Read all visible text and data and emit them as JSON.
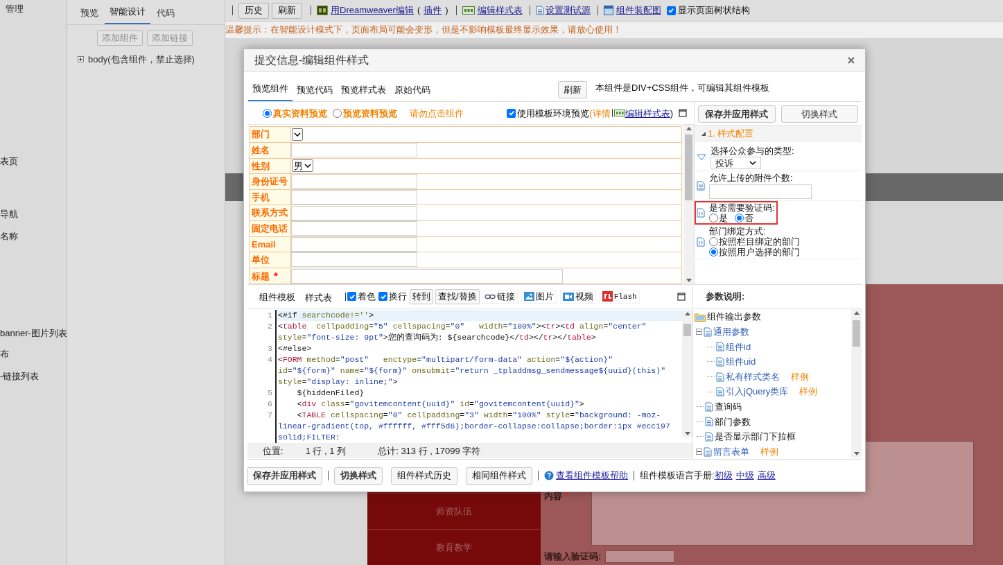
{
  "background": {
    "left_labels": [
      "管理",
      "表页",
      "导航",
      "名称",
      "banner-图片列表",
      "布",
      "-链接列表"
    ],
    "tabs": [
      {
        "label": "预览",
        "selected": false
      },
      {
        "label": "智能设计",
        "selected": true
      },
      {
        "label": "代码",
        "selected": false
      }
    ],
    "sidebar_buttons": [
      {
        "label": "添加组件",
        "disabled": true
      },
      {
        "label": "添加链接",
        "disabled": true
      }
    ],
    "tree_item": "body(包含组件，禁止选择)",
    "toolbar": [
      {
        "kind": "button",
        "label": "历史",
        "sep_before": true
      },
      {
        "kind": "button",
        "label": "刷新",
        "sep_before": false
      },
      {
        "kind": "link",
        "label": "用Dreamweaver编辑",
        "sep_before": true
      },
      {
        "kind": "text",
        "label": "(",
        "sep_before": false
      },
      {
        "kind": "link",
        "label": "插件",
        "sep_before": false
      },
      {
        "kind": "text",
        "label": ")",
        "sep_before": false
      },
      {
        "kind": "link",
        "label": "编辑样式表",
        "sep_before": true
      },
      {
        "kind": "link",
        "label": "设置测试源",
        "sep_before": true
      },
      {
        "kind": "link",
        "label": "组件装配图",
        "sep_before": true
      },
      {
        "kind": "checkbox",
        "label": "显示页面树状结构",
        "checked": true,
        "sep_before": false
      }
    ],
    "notice": "温馨提示：在智能设计模式下，页面布局可能会变形，但是不影响模板最终显示效果，请放心使用！",
    "canvas": {
      "cells": [
        "师资队伍",
        "教育教学"
      ],
      "content_label": "内容",
      "content_required": true,
      "content_required_mark": "*",
      "captcha_label": "请输入验证码:"
    }
  },
  "dialog": {
    "title": "提交信息-编辑组件样式",
    "tabs": [
      {
        "label": "预览组件",
        "selected": true
      },
      {
        "label": "预览代码",
        "selected": false
      },
      {
        "label": "预览样式表",
        "selected": false
      },
      {
        "label": "原始代码",
        "selected": false
      }
    ],
    "refresh_button": "刷新",
    "info": "本组件是DIV+CSS组件，可编辑其组件模板",
    "preview_modes": [
      {
        "label": "真实资料预览",
        "selected": true
      },
      {
        "label": "预览资料预览",
        "selected": false
      }
    ],
    "warning": "请勿点击组件",
    "env_preview": {
      "label": "使用模板环境预览",
      "checked": true,
      "open": "(",
      "details": "详情",
      "stylesheet_link": "编辑样式表",
      "close": ")"
    },
    "form_rows": [
      {
        "label": "部门",
        "kind": "select",
        "required": false
      },
      {
        "label": "姓名",
        "kind": "input",
        "required": false
      },
      {
        "label": "性别",
        "kind": "select",
        "value": "男",
        "required": false
      },
      {
        "label": "身份证号",
        "kind": "input",
        "required": false
      },
      {
        "label": "手机",
        "kind": "input",
        "required": false
      },
      {
        "label": "联系方式",
        "kind": "input",
        "required": false
      },
      {
        "label": "固定电话",
        "kind": "input",
        "required": false
      },
      {
        "label": "Email",
        "kind": "input",
        "required": false
      },
      {
        "label": "单位",
        "kind": "input",
        "required": false
      },
      {
        "label": "标题",
        "kind": "wide-input",
        "required": true,
        "required_mark": "*"
      }
    ],
    "side_buttons": [
      "保存并应用样式",
      "切换样式"
    ],
    "config_section": {
      "title": "1.  样式配置",
      "expanded": true
    },
    "config_items": [
      {
        "kind": "select",
        "label": "选择公众参与的类型:",
        "value": "投诉",
        "highlighted": false
      },
      {
        "kind": "text",
        "label": "允许上传的附件个数:",
        "highlighted": false
      },
      {
        "kind": "radio-inline",
        "label": "是否需要验证码:",
        "highlighted": true,
        "options": [
          {
            "label": "是",
            "selected": false
          },
          {
            "label": "否",
            "selected": true
          }
        ]
      },
      {
        "kind": "radio-list",
        "label": "部门绑定方式:",
        "highlighted": false,
        "options": [
          {
            "label": "按照栏目绑定的部门",
            "selected": false
          },
          {
            "label": "按照用户选择的部门",
            "selected": true
          }
        ]
      }
    ],
    "editor_tabs": [
      {
        "label": "组件模板",
        "selected": true
      },
      {
        "label": "样式表",
        "selected": false
      }
    ],
    "editor_tools": [
      {
        "kind": "checkbox",
        "label": "着色",
        "checked": true
      },
      {
        "kind": "checkbox",
        "label": "换行",
        "checked": true
      },
      {
        "kind": "button",
        "label": "转到"
      },
      {
        "kind": "button",
        "label": "查找/替换"
      },
      {
        "kind": "icon-button",
        "label": "链接"
      },
      {
        "kind": "icon-button",
        "label": "图片"
      },
      {
        "kind": "icon-button",
        "label": "视频"
      },
      {
        "kind": "icon-button",
        "label": "Flash"
      }
    ],
    "code_rows": [
      {
        "num": "1",
        "current": true,
        "segs": [
          {
            "text": "<#if ",
            "kind": "plain"
          },
          {
            "text": "searchcode!=''",
            "kind": "attr"
          },
          {
            "text": ">",
            "kind": "plain"
          }
        ]
      },
      {
        "num": "2",
        "current": false,
        "segs": [
          {
            "text": "<",
            "kind": "plain"
          },
          {
            "text": "table",
            "kind": "tag"
          },
          {
            "text": "  cellpadding",
            "kind": "attr"
          },
          {
            "text": "=",
            "kind": "plain"
          },
          {
            "text": "\"5\"",
            "kind": "string"
          },
          {
            "text": " cellspacing",
            "kind": "attr"
          },
          {
            "text": "=",
            "kind": "plain"
          },
          {
            "text": "\"0\"",
            "kind": "string"
          },
          {
            "text": "   width",
            "kind": "attr"
          },
          {
            "text": "=",
            "kind": "plain"
          },
          {
            "text": "\"100%\"",
            "kind": "string"
          },
          {
            "text": "><",
            "kind": "plain"
          },
          {
            "text": "tr",
            "kind": "tag"
          },
          {
            "text": "><",
            "kind": "plain"
          },
          {
            "text": "td",
            "kind": "tag"
          },
          {
            "text": " align",
            "kind": "attr"
          },
          {
            "text": "=",
            "kind": "plain"
          },
          {
            "text": "\"center\"",
            "kind": "string"
          }
        ]
      },
      {
        "current": false,
        "segs": [
          {
            "text": "style",
            "kind": "attr"
          },
          {
            "text": "=",
            "kind": "plain"
          },
          {
            "text": "\"font-size: 9pt\"",
            "kind": "string"
          },
          {
            "text": ">您的查询码为: ${searchcode}</",
            "kind": "plain"
          },
          {
            "text": "td",
            "kind": "tag"
          },
          {
            "text": "></",
            "kind": "plain"
          },
          {
            "text": "tr",
            "kind": "tag"
          },
          {
            "text": "></",
            "kind": "plain"
          },
          {
            "text": "table",
            "kind": "tag"
          },
          {
            "text": ">",
            "kind": "plain"
          }
        ]
      },
      {
        "num": "3",
        "current": false,
        "segs": [
          {
            "text": "<#else>",
            "kind": "plain"
          }
        ]
      },
      {
        "num": "4",
        "current": false,
        "segs": [
          {
            "text": "<",
            "kind": "plain"
          },
          {
            "text": "FORM",
            "kind": "tag"
          },
          {
            "text": " method",
            "kind": "attr"
          },
          {
            "text": "=",
            "kind": "plain"
          },
          {
            "text": "\"post\"",
            "kind": "string"
          },
          {
            "text": "   enctype",
            "kind": "attr"
          },
          {
            "text": "=",
            "kind": "plain"
          },
          {
            "text": "\"multipart/form-data\"",
            "kind": "string"
          },
          {
            "text": " action",
            "kind": "attr"
          },
          {
            "text": "=",
            "kind": "plain"
          },
          {
            "text": "\"${action}\"",
            "kind": "string"
          }
        ]
      },
      {
        "current": false,
        "segs": [
          {
            "text": "id",
            "kind": "attr"
          },
          {
            "text": "=",
            "kind": "plain"
          },
          {
            "text": "\"${form}\"",
            "kind": "string"
          },
          {
            "text": " name",
            "kind": "attr"
          },
          {
            "text": "=",
            "kind": "plain"
          },
          {
            "text": "\"${form}\"",
            "kind": "string"
          },
          {
            "text": " onsubmit",
            "kind": "attr"
          },
          {
            "text": "=",
            "kind": "plain"
          },
          {
            "text": "\"return _tpladdmsg_sendmessage${uuid}(this)\"",
            "kind": "string"
          }
        ]
      },
      {
        "current": false,
        "segs": [
          {
            "text": "style",
            "kind": "attr"
          },
          {
            "text": "=",
            "kind": "plain"
          },
          {
            "text": "\"display: inline;\"",
            "kind": "string"
          },
          {
            "text": ">",
            "kind": "plain"
          }
        ]
      },
      {
        "num": "5",
        "current": false,
        "segs": [
          {
            "text": "    ${hiddenFiled}",
            "kind": "plain"
          }
        ]
      },
      {
        "num": "6",
        "current": false,
        "segs": [
          {
            "text": "    <",
            "kind": "plain"
          },
          {
            "text": "div",
            "kind": "tag"
          },
          {
            "text": " class",
            "kind": "attr"
          },
          {
            "text": "=",
            "kind": "plain"
          },
          {
            "text": "\"govitemcontent{uuid}\"",
            "kind": "string"
          },
          {
            "text": " id",
            "kind": "attr"
          },
          {
            "text": "=",
            "kind": "plain"
          },
          {
            "text": "\"govitemcontent{uuid}\"",
            "kind": "string"
          },
          {
            "text": ">",
            "kind": "plain"
          }
        ]
      },
      {
        "num": "7",
        "current": false,
        "segs": [
          {
            "text": "    <",
            "kind": "plain"
          },
          {
            "text": "TABLE",
            "kind": "tag"
          },
          {
            "text": " cellspacing",
            "kind": "attr"
          },
          {
            "text": "=",
            "kind": "plain"
          },
          {
            "text": "\"0\"",
            "kind": "string"
          },
          {
            "text": " cellpadding",
            "kind": "attr"
          },
          {
            "text": "=",
            "kind": "plain"
          },
          {
            "text": "\"3\"",
            "kind": "string"
          },
          {
            "text": " width",
            "kind": "attr"
          },
          {
            "text": "=",
            "kind": "plain"
          },
          {
            "text": "\"100%\"",
            "kind": "string"
          },
          {
            "text": " style",
            "kind": "attr"
          },
          {
            "text": "=",
            "kind": "plain"
          },
          {
            "text": "\"background: -moz-",
            "kind": "string"
          }
        ]
      },
      {
        "current": false,
        "segs": [
          {
            "text": "linear-gradient(top, #ffffff, #fff5d6);border-collapse:collapse;border:1px #ecc197",
            "kind": "string"
          }
        ]
      },
      {
        "current": false,
        "segs": [
          {
            "text": "solid;FILTER:",
            "kind": "string"
          }
        ]
      }
    ],
    "status_bar": {
      "position_label": "位置:",
      "position": "1 行 , 1 列",
      "total": "总计: 313 行 , 17099 字符"
    },
    "params_title": "参数说明:",
    "params_tree": [
      {
        "label": "组件输出参数",
        "kind": "folder",
        "children": [
          {
            "label": "通用参数",
            "kind": "link",
            "expanded": true,
            "children": [
              {
                "label": "组件id",
                "kind": "link"
              },
              {
                "label": "组件uid",
                "kind": "link"
              },
              {
                "label": "私有样式类名",
                "kind": "link",
                "example": "样例"
              },
              {
                "label": "引入jQuery类库",
                "kind": "link",
                "example": "样例"
              }
            ]
          },
          {
            "label": "查询码",
            "kind": "plain"
          },
          {
            "label": "部门参数",
            "kind": "plain"
          },
          {
            "label": "是否显示部门下拉框",
            "kind": "plain"
          },
          {
            "label": "留言表单",
            "kind": "link",
            "expanded": true,
            "example": "样例"
          }
        ]
      }
    ],
    "bottom_bar": [
      {
        "kind": "primary",
        "label": "保存并应用样式",
        "sep_before": false
      },
      {
        "kind": "primary",
        "label": "切换样式",
        "sep_before": true
      },
      {
        "kind": "button",
        "label": "组件样式历史",
        "sep_before": false
      },
      {
        "kind": "button",
        "label": "相同组件样式",
        "sep_before": false
      },
      {
        "kind": "help-link",
        "label": "查看组件模板帮助",
        "sep_before": true
      },
      {
        "kind": "text",
        "label": "组件模板语言手册:",
        "sep_before": true
      },
      {
        "kind": "link",
        "label": "初级",
        "sep_before": false
      },
      {
        "kind": "link",
        "label": "中级",
        "sep_before": false
      },
      {
        "kind": "link",
        "label": "高级",
        "sep_before": false
      }
    ]
  }
}
